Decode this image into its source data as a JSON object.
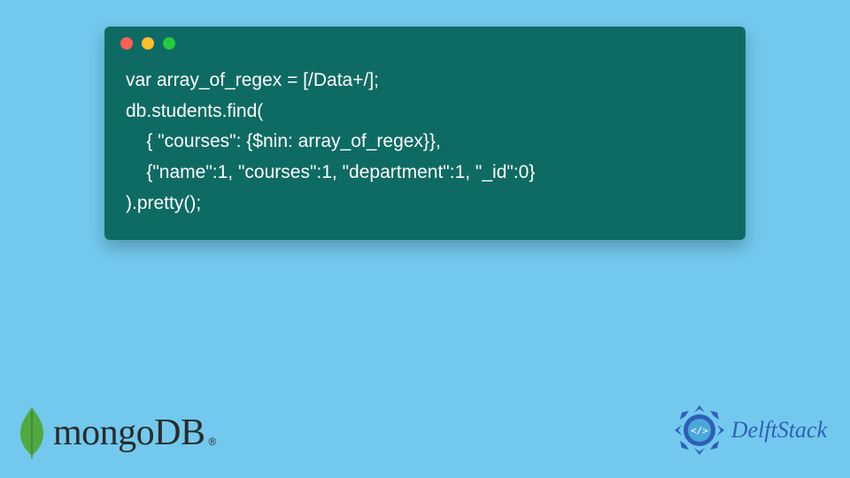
{
  "code": {
    "line1": "var array_of_regex = [/Data+/];",
    "line2": "db.students.find(",
    "line3": "    { \"courses\": {$nin: array_of_regex}},",
    "line4": "    {\"name\":1, \"courses\":1, \"department\":1, \"_id\":0}",
    "line5": ").pretty();"
  },
  "logos": {
    "mongo": "mongoDB",
    "mongo_reg": "®",
    "delft": "DelftStack"
  },
  "colors": {
    "background": "#72c9ed",
    "code_bg": "#0e6b63",
    "mongo_leaf": "#4FAA41",
    "delft_blue": "#2f5fb8"
  }
}
